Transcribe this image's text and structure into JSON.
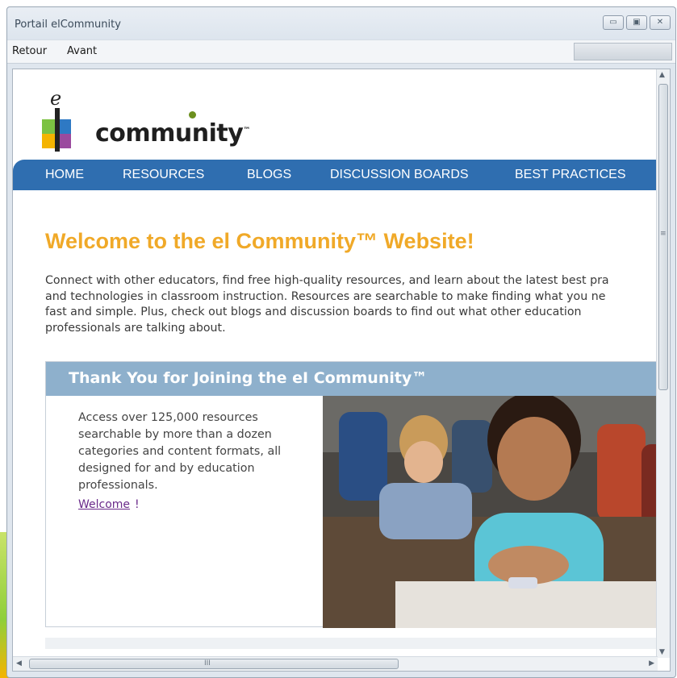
{
  "window": {
    "title": "Portail elCommunity",
    "controls": {
      "minimize": "▭",
      "maximize": "▣",
      "close": "✕"
    }
  },
  "menu": {
    "back_label": "Retour",
    "forward_label": "Avant"
  },
  "logo": {
    "letter": "e",
    "word": "community",
    "tm": "™",
    "colors": [
      "#7cc242",
      "#f4b400",
      "#2e79c4",
      "#9b4a9e"
    ]
  },
  "nav": {
    "items": [
      "HOME",
      "RESOURCES",
      "BLOGS",
      "DISCUSSION BOARDS",
      "BEST PRACTICES"
    ],
    "background": "#2f6eb0"
  },
  "welcome": {
    "title": "Welcome to the el Community™ Website!",
    "title_color": "#f0a928",
    "intro_lines": [
      "Connect with other educators, find free high-quality resources, and learn about the latest best pra",
      "and technologies in classroom instruction. Resources are searchable to make finding what you ne",
      "fast and simple. Plus, check out blogs and discussion boards to find out what other education",
      "professionals are talking about."
    ]
  },
  "panel": {
    "title": "Thank You for Joining the eI Community™",
    "lines": [
      "Access over 125,000 resources",
      "searchable by more than a dozen",
      "categories and content formats, all",
      "designed for and by education",
      "professionals."
    ],
    "link_text": "Welcome",
    "link_suffix": "!"
  },
  "scrollbars": {
    "up_arrow": "▲",
    "down_arrow": "▼",
    "left_arrow": "◀",
    "right_arrow": "▶",
    "v_grip": "≡",
    "h_grip": "III"
  }
}
